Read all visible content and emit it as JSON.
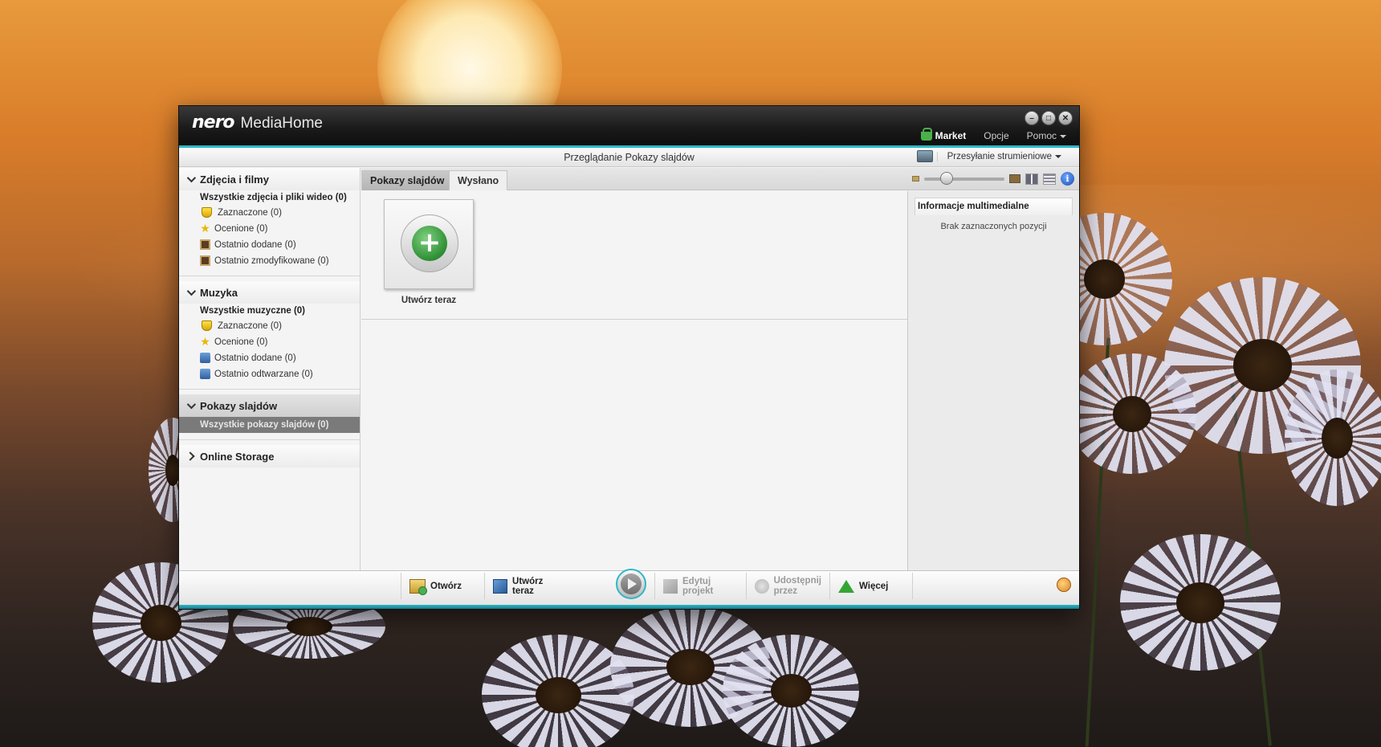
{
  "window": {
    "logo_brand": "nero",
    "app_name": "MediaHome",
    "controls": [
      "minimize-icon",
      "maximize-icon",
      "close-icon"
    ]
  },
  "topmenu": {
    "market": "Market",
    "options": "Opcje",
    "help": "Pomoc"
  },
  "browse": {
    "title": "Przeglądanie Pokazy slajdów",
    "streaming": "Przesyłanie strumieniowe"
  },
  "sidebar": {
    "photos": {
      "title": "Zdjęcia i filmy",
      "all": "Wszystkie zdjęcia i pliki wideo (0)",
      "items": [
        {
          "label": "Zaznaczone (0)",
          "icon": "flag-icon"
        },
        {
          "label": "Ocenione (0)",
          "icon": "star-icon"
        },
        {
          "label": "Ostatnio dodane (0)",
          "icon": "photo-icon"
        },
        {
          "label": "Ostatnio zmodyfikowane (0)",
          "icon": "photo-icon"
        }
      ]
    },
    "music": {
      "title": "Muzyka",
      "all": "Wszystkie muzyczne (0)",
      "items": [
        {
          "label": "Zaznaczone (0)",
          "icon": "flag-icon"
        },
        {
          "label": "Ocenione (0)",
          "icon": "star-icon"
        },
        {
          "label": "Ostatnio dodane (0)",
          "icon": "music-note-icon"
        },
        {
          "label": "Ostatnio odtwarzane (0)",
          "icon": "music-note-icon"
        }
      ]
    },
    "slideshows": {
      "title": "Pokazy slajdów",
      "all": "Wszystkie pokazy slajdów (0)"
    },
    "online": {
      "title": "Online Storage"
    }
  },
  "tabs": [
    {
      "label": "Pokazy slajdów",
      "active": true
    },
    {
      "label": "Wysłano",
      "active": false
    }
  ],
  "content": {
    "create_label": "Utwórz teraz"
  },
  "infopanel": {
    "title": "Informacje multimedialne",
    "empty": "Brak zaznaczonych pozycji"
  },
  "toolbar": {
    "open": "Otwórz",
    "create": "Utwórz teraz",
    "edit": "Edytuj projekt",
    "share": "Udostępnij przez",
    "more": "Więcej"
  },
  "colors": {
    "accent": "#2fb7c7",
    "selected_row": "#7a7a7a",
    "market_green": "#49b04a"
  }
}
